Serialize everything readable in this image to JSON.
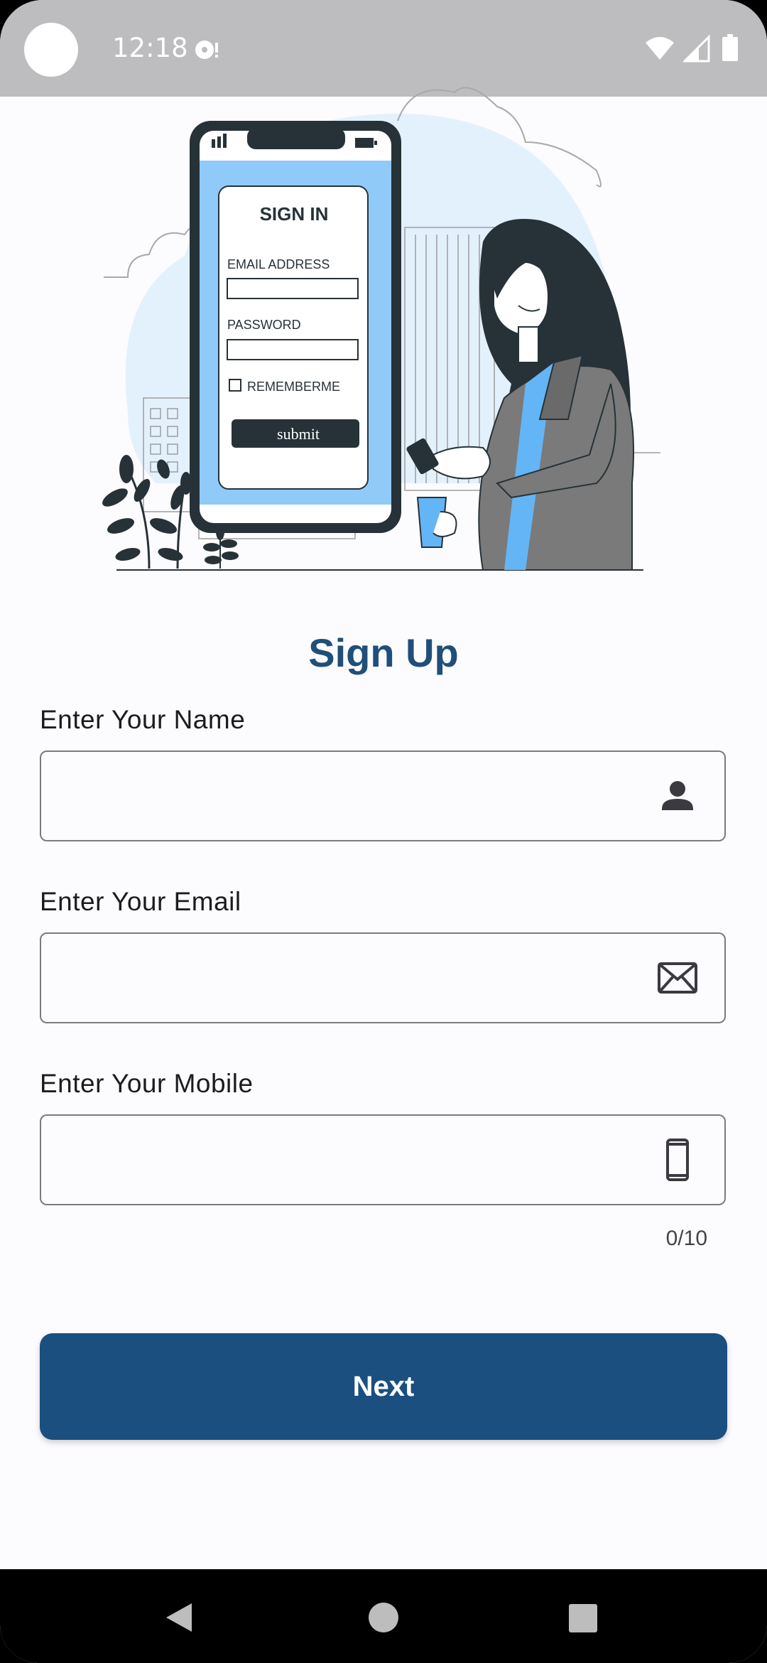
{
  "status_bar": {
    "time": "12:18"
  },
  "illustration": {
    "form_title": "SIGN IN",
    "email_label": "EMAIL ADDRESS",
    "password_label": "PASSWORD",
    "remember_label": "REMEMBERME",
    "submit_label": "submit"
  },
  "form": {
    "title": "Sign Up",
    "name": {
      "label": "Enter Your Name",
      "value": "",
      "icon": "person-icon"
    },
    "email": {
      "label": "Enter Your Email",
      "value": "",
      "icon": "envelope-icon"
    },
    "mobile": {
      "label": "Enter Your Mobile",
      "value": "",
      "icon": "smartphone-icon",
      "counter": "0/10"
    },
    "next_label": "Next"
  },
  "colors": {
    "accent": "#1a4f80",
    "title": "#1f4f7a",
    "illustration_blue": "#90caf9"
  }
}
